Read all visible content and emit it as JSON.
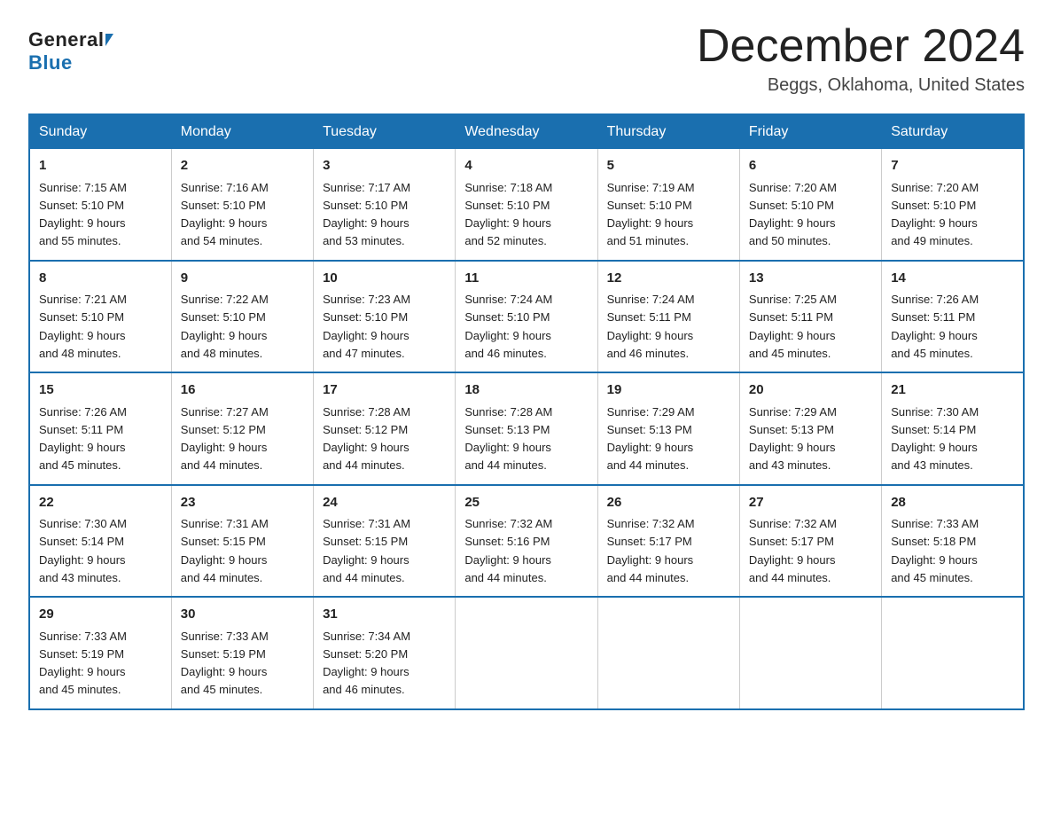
{
  "header": {
    "logo_general": "General",
    "logo_blue": "Blue",
    "month_title": "December 2024",
    "location": "Beggs, Oklahoma, United States"
  },
  "weekdays": [
    "Sunday",
    "Monday",
    "Tuesday",
    "Wednesday",
    "Thursday",
    "Friday",
    "Saturday"
  ],
  "weeks": [
    [
      {
        "day": "1",
        "sunrise": "7:15 AM",
        "sunset": "5:10 PM",
        "daylight": "9 hours and 55 minutes."
      },
      {
        "day": "2",
        "sunrise": "7:16 AM",
        "sunset": "5:10 PM",
        "daylight": "9 hours and 54 minutes."
      },
      {
        "day": "3",
        "sunrise": "7:17 AM",
        "sunset": "5:10 PM",
        "daylight": "9 hours and 53 minutes."
      },
      {
        "day": "4",
        "sunrise": "7:18 AM",
        "sunset": "5:10 PM",
        "daylight": "9 hours and 52 minutes."
      },
      {
        "day": "5",
        "sunrise": "7:19 AM",
        "sunset": "5:10 PM",
        "daylight": "9 hours and 51 minutes."
      },
      {
        "day": "6",
        "sunrise": "7:20 AM",
        "sunset": "5:10 PM",
        "daylight": "9 hours and 50 minutes."
      },
      {
        "day": "7",
        "sunrise": "7:20 AM",
        "sunset": "5:10 PM",
        "daylight": "9 hours and 49 minutes."
      }
    ],
    [
      {
        "day": "8",
        "sunrise": "7:21 AM",
        "sunset": "5:10 PM",
        "daylight": "9 hours and 48 minutes."
      },
      {
        "day": "9",
        "sunrise": "7:22 AM",
        "sunset": "5:10 PM",
        "daylight": "9 hours and 48 minutes."
      },
      {
        "day": "10",
        "sunrise": "7:23 AM",
        "sunset": "5:10 PM",
        "daylight": "9 hours and 47 minutes."
      },
      {
        "day": "11",
        "sunrise": "7:24 AM",
        "sunset": "5:10 PM",
        "daylight": "9 hours and 46 minutes."
      },
      {
        "day": "12",
        "sunrise": "7:24 AM",
        "sunset": "5:11 PM",
        "daylight": "9 hours and 46 minutes."
      },
      {
        "day": "13",
        "sunrise": "7:25 AM",
        "sunset": "5:11 PM",
        "daylight": "9 hours and 45 minutes."
      },
      {
        "day": "14",
        "sunrise": "7:26 AM",
        "sunset": "5:11 PM",
        "daylight": "9 hours and 45 minutes."
      }
    ],
    [
      {
        "day": "15",
        "sunrise": "7:26 AM",
        "sunset": "5:11 PM",
        "daylight": "9 hours and 45 minutes."
      },
      {
        "day": "16",
        "sunrise": "7:27 AM",
        "sunset": "5:12 PM",
        "daylight": "9 hours and 44 minutes."
      },
      {
        "day": "17",
        "sunrise": "7:28 AM",
        "sunset": "5:12 PM",
        "daylight": "9 hours and 44 minutes."
      },
      {
        "day": "18",
        "sunrise": "7:28 AM",
        "sunset": "5:13 PM",
        "daylight": "9 hours and 44 minutes."
      },
      {
        "day": "19",
        "sunrise": "7:29 AM",
        "sunset": "5:13 PM",
        "daylight": "9 hours and 44 minutes."
      },
      {
        "day": "20",
        "sunrise": "7:29 AM",
        "sunset": "5:13 PM",
        "daylight": "9 hours and 43 minutes."
      },
      {
        "day": "21",
        "sunrise": "7:30 AM",
        "sunset": "5:14 PM",
        "daylight": "9 hours and 43 minutes."
      }
    ],
    [
      {
        "day": "22",
        "sunrise": "7:30 AM",
        "sunset": "5:14 PM",
        "daylight": "9 hours and 43 minutes."
      },
      {
        "day": "23",
        "sunrise": "7:31 AM",
        "sunset": "5:15 PM",
        "daylight": "9 hours and 44 minutes."
      },
      {
        "day": "24",
        "sunrise": "7:31 AM",
        "sunset": "5:15 PM",
        "daylight": "9 hours and 44 minutes."
      },
      {
        "day": "25",
        "sunrise": "7:32 AM",
        "sunset": "5:16 PM",
        "daylight": "9 hours and 44 minutes."
      },
      {
        "day": "26",
        "sunrise": "7:32 AM",
        "sunset": "5:17 PM",
        "daylight": "9 hours and 44 minutes."
      },
      {
        "day": "27",
        "sunrise": "7:32 AM",
        "sunset": "5:17 PM",
        "daylight": "9 hours and 44 minutes."
      },
      {
        "day": "28",
        "sunrise": "7:33 AM",
        "sunset": "5:18 PM",
        "daylight": "9 hours and 45 minutes."
      }
    ],
    [
      {
        "day": "29",
        "sunrise": "7:33 AM",
        "sunset": "5:19 PM",
        "daylight": "9 hours and 45 minutes."
      },
      {
        "day": "30",
        "sunrise": "7:33 AM",
        "sunset": "5:19 PM",
        "daylight": "9 hours and 45 minutes."
      },
      {
        "day": "31",
        "sunrise": "7:34 AM",
        "sunset": "5:20 PM",
        "daylight": "9 hours and 46 minutes."
      },
      null,
      null,
      null,
      null
    ]
  ],
  "labels": {
    "sunrise": "Sunrise:",
    "sunset": "Sunset:",
    "daylight": "Daylight:"
  }
}
